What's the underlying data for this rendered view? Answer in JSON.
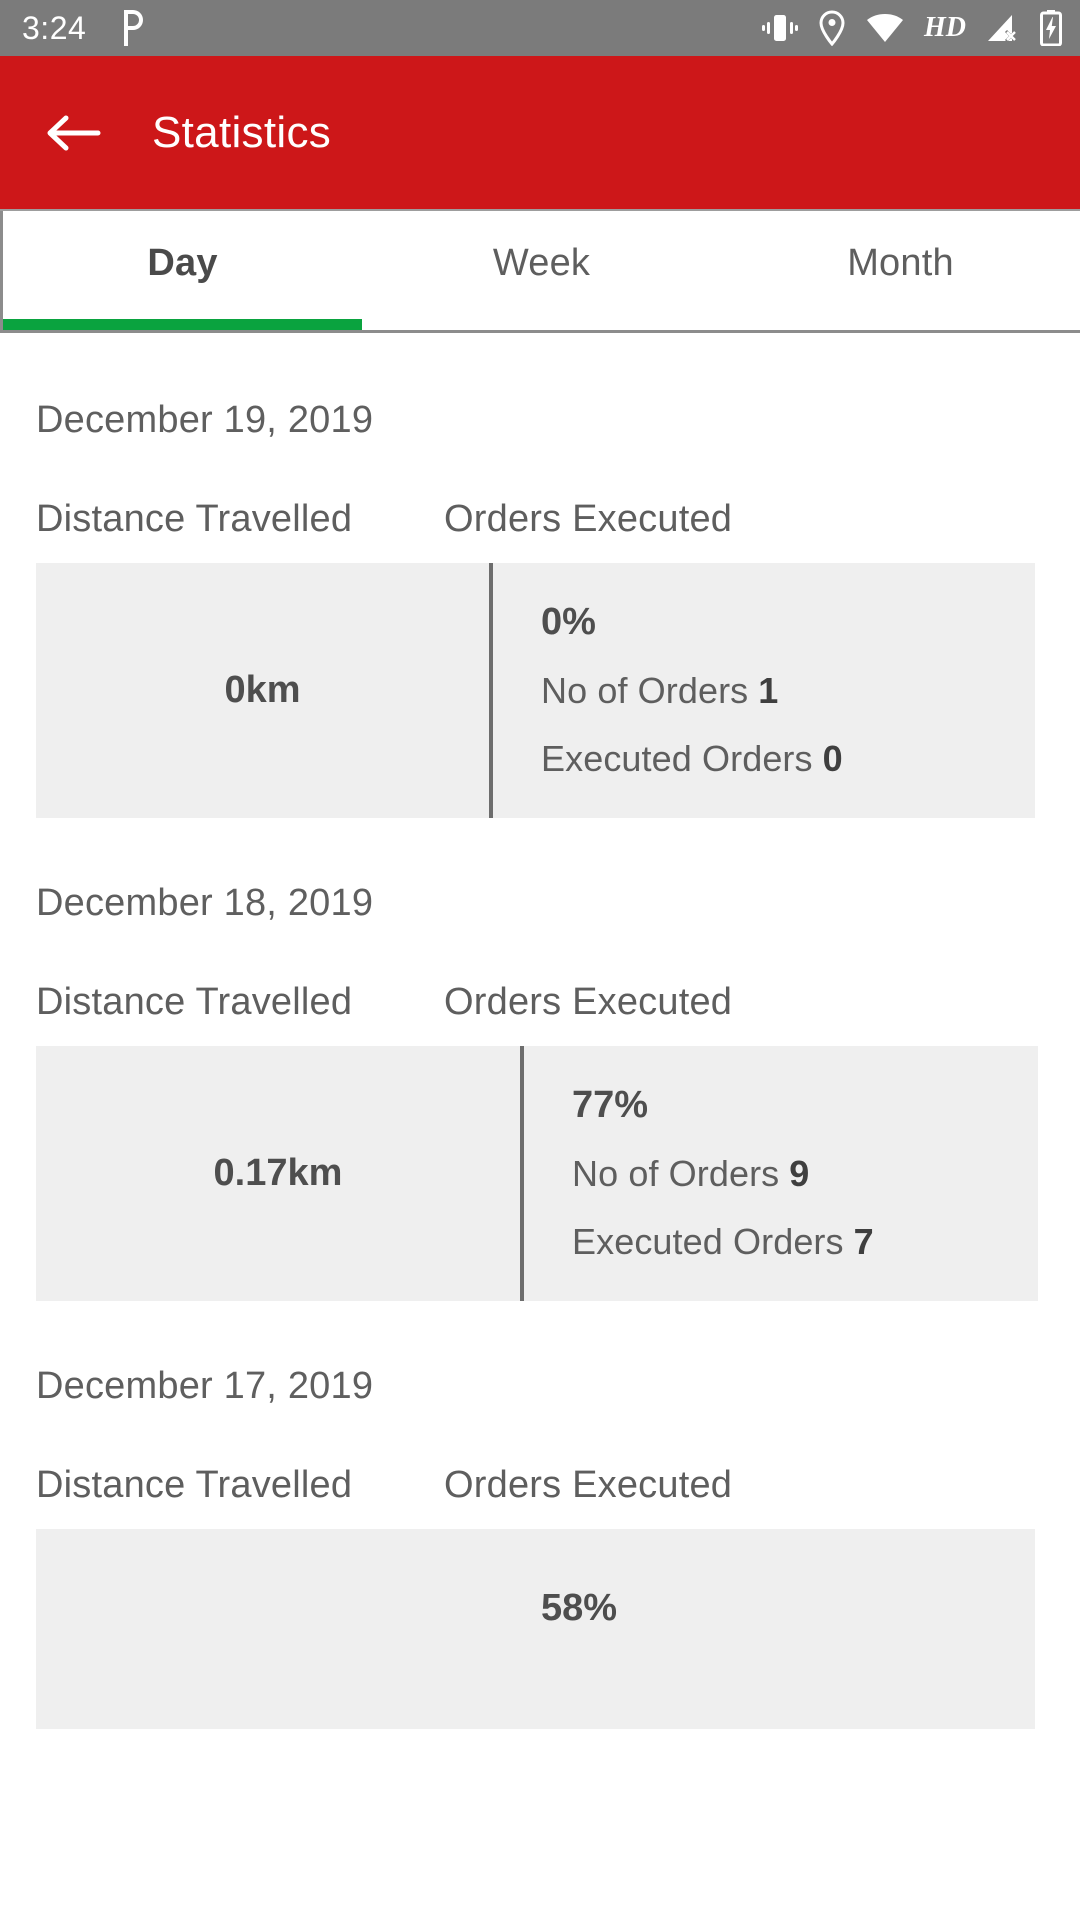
{
  "status_bar": {
    "time": "3:24",
    "app_icon": "p-app-icon",
    "icons": [
      "vibrate-icon",
      "location-pin-icon",
      "wifi-icon",
      "hd-icon",
      "signal-off-icon",
      "battery-charging-icon"
    ],
    "hd_label": "HD",
    "background": "#7b7b7b"
  },
  "app_bar": {
    "back_icon": "back-arrow-icon",
    "title": "Statistics",
    "background": "#cd1719"
  },
  "tabs": {
    "items": [
      {
        "label": "Day",
        "selected": true
      },
      {
        "label": "Week",
        "selected": false
      },
      {
        "label": "Month",
        "selected": false
      }
    ],
    "indicator_color": "#0aa33f"
  },
  "labels": {
    "distance_header": "Distance Travelled",
    "orders_header": "Orders Executed",
    "no_of_orders": "No of Orders",
    "executed_orders": "Executed Orders"
  },
  "days": [
    {
      "date": "December 19, 2019",
      "distance": "0km",
      "percent": "0%",
      "no_of_orders": "1",
      "executed_orders": "0"
    },
    {
      "date": "December 18, 2019",
      "distance": "0.17km",
      "percent": "77%",
      "no_of_orders": "9",
      "executed_orders": "7"
    },
    {
      "date": "December 17, 2019",
      "distance": "",
      "percent": "58%",
      "no_of_orders": "",
      "executed_orders": ""
    }
  ]
}
